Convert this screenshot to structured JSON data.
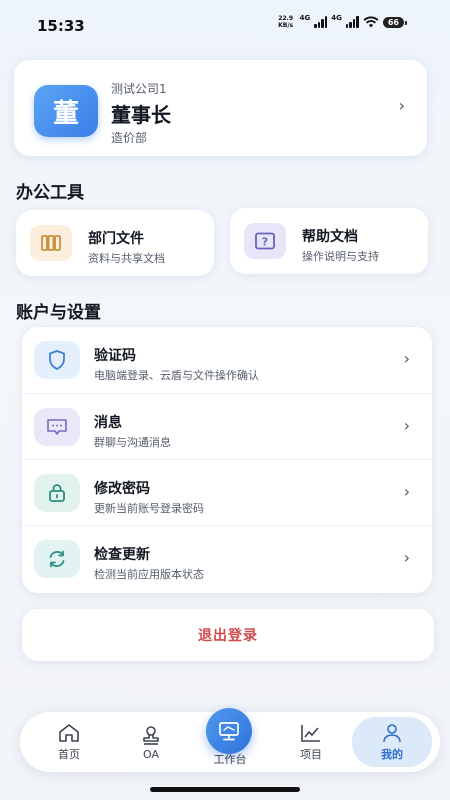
{
  "status_bar": {
    "time": "15:33",
    "net_speed_value": "22.9",
    "net_speed_unit": "KB/s",
    "network_1": "4G",
    "network_2": "4G",
    "battery": "66"
  },
  "profile": {
    "avatar_char": "董",
    "company": "测试公司1",
    "role": "董事长",
    "department": "造价部"
  },
  "office_tools": {
    "title": "办公工具",
    "items": [
      {
        "title": "部门文件",
        "subtitle": "资料与共享文档",
        "icon": "folder-books-icon"
      },
      {
        "title": "帮助文档",
        "subtitle": "操作说明与支持",
        "icon": "help-question-icon"
      }
    ]
  },
  "account_settings": {
    "title": "账户与设置",
    "items": [
      {
        "title": "验证码",
        "subtitle": "电脑端登录、云盾与文件操作确认",
        "icon": "shield-icon"
      },
      {
        "title": "消息",
        "subtitle": "群聊与沟通消息",
        "icon": "message-icon"
      },
      {
        "title": "修改密码",
        "subtitle": "更新当前账号登录密码",
        "icon": "lock-icon"
      },
      {
        "title": "检查更新",
        "subtitle": "检测当前应用版本状态",
        "icon": "refresh-icon"
      }
    ]
  },
  "logout": {
    "label": "退出登录"
  },
  "tab_bar": {
    "tabs": [
      {
        "label": "首页",
        "icon": "home-icon"
      },
      {
        "label": "OA",
        "icon": "oa-stamp-icon"
      },
      {
        "label": "工作台",
        "icon": "monitor-icon"
      },
      {
        "label": "项目",
        "icon": "chart-icon"
      },
      {
        "label": "我的",
        "icon": "user-icon",
        "active": true
      }
    ]
  },
  "colors": {
    "accent": "#3a7fe8",
    "danger": "#d14b4b",
    "tab_active_bg": "#dbe9f9"
  }
}
